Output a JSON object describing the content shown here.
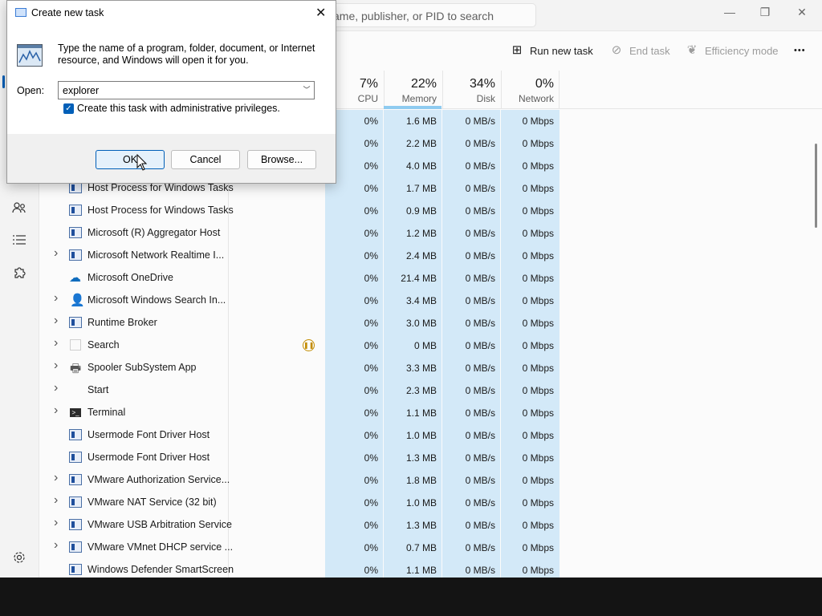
{
  "search": {
    "placeholder": "ame, publisher, or PID to search"
  },
  "window_controls": {
    "minimize": "—",
    "maximize": "❐",
    "close": "✕"
  },
  "toolbar": {
    "run_new_task": "Run new task",
    "end_task": "End task",
    "efficiency_mode": "Efficiency mode",
    "more": "•••"
  },
  "columns": {
    "cpu": {
      "pct": "7%",
      "label": "CPU"
    },
    "memory": {
      "pct": "22%",
      "label": "Memory"
    },
    "disk": {
      "pct": "34%",
      "label": "Disk"
    },
    "network": {
      "pct": "0%",
      "label": "Network"
    }
  },
  "processes": [
    {
      "name": "",
      "expand": false,
      "icon": "none",
      "cpu": "0%",
      "memory": "1.6 MB",
      "disk": "0 MB/s",
      "network": "0 Mbps"
    },
    {
      "name": "",
      "expand": false,
      "icon": "none",
      "cpu": "0%",
      "memory": "2.2 MB",
      "disk": "0 MB/s",
      "network": "0 Mbps"
    },
    {
      "name": "",
      "expand": false,
      "icon": "none",
      "cpu": "0%",
      "memory": "4.0 MB",
      "disk": "0 MB/s",
      "network": "0 Mbps"
    },
    {
      "name": "Host Process for Windows Tasks",
      "expand": false,
      "icon": "app",
      "cpu": "0%",
      "memory": "1.7 MB",
      "disk": "0 MB/s",
      "network": "0 Mbps"
    },
    {
      "name": "Host Process for Windows Tasks",
      "expand": false,
      "icon": "app",
      "cpu": "0%",
      "memory": "0.9 MB",
      "disk": "0 MB/s",
      "network": "0 Mbps"
    },
    {
      "name": "Microsoft (R) Aggregator Host",
      "expand": false,
      "icon": "app",
      "cpu": "0%",
      "memory": "1.2 MB",
      "disk": "0 MB/s",
      "network": "0 Mbps"
    },
    {
      "name": "Microsoft Network Realtime I...",
      "expand": true,
      "icon": "app",
      "cpu": "0%",
      "memory": "2.4 MB",
      "disk": "0 MB/s",
      "network": "0 Mbps"
    },
    {
      "name": "Microsoft OneDrive",
      "expand": false,
      "icon": "cloud",
      "cpu": "0%",
      "memory": "21.4 MB",
      "disk": "0 MB/s",
      "network": "0 Mbps"
    },
    {
      "name": "Microsoft Windows Search In...",
      "expand": true,
      "icon": "search-user",
      "cpu": "0%",
      "memory": "3.4 MB",
      "disk": "0 MB/s",
      "network": "0 Mbps"
    },
    {
      "name": "Runtime Broker",
      "expand": true,
      "icon": "app",
      "cpu": "0%",
      "memory": "3.0 MB",
      "disk": "0 MB/s",
      "network": "0 Mbps"
    },
    {
      "name": "Search",
      "expand": true,
      "icon": "blank",
      "paused": true,
      "cpu": "0%",
      "memory": "0 MB",
      "disk": "0 MB/s",
      "network": "0 Mbps"
    },
    {
      "name": "Spooler SubSystem App",
      "expand": true,
      "icon": "printer",
      "cpu": "0%",
      "memory": "3.3 MB",
      "disk": "0 MB/s",
      "network": "0 Mbps"
    },
    {
      "name": "Start",
      "expand": true,
      "icon": "none",
      "cpu": "0%",
      "memory": "2.3 MB",
      "disk": "0 MB/s",
      "network": "0 Mbps"
    },
    {
      "name": "Terminal",
      "expand": true,
      "icon": "terminal",
      "cpu": "0%",
      "memory": "1.1 MB",
      "disk": "0 MB/s",
      "network": "0 Mbps"
    },
    {
      "name": "Usermode Font Driver Host",
      "expand": false,
      "icon": "app",
      "cpu": "0%",
      "memory": "1.0 MB",
      "disk": "0 MB/s",
      "network": "0 Mbps"
    },
    {
      "name": "Usermode Font Driver Host",
      "expand": false,
      "icon": "app",
      "cpu": "0%",
      "memory": "1.3 MB",
      "disk": "0 MB/s",
      "network": "0 Mbps"
    },
    {
      "name": "VMware Authorization Service...",
      "expand": true,
      "icon": "app",
      "cpu": "0%",
      "memory": "1.8 MB",
      "disk": "0 MB/s",
      "network": "0 Mbps"
    },
    {
      "name": "VMware NAT Service (32 bit)",
      "expand": true,
      "icon": "app",
      "cpu": "0%",
      "memory": "1.0 MB",
      "disk": "0 MB/s",
      "network": "0 Mbps"
    },
    {
      "name": "VMware USB Arbitration Service",
      "expand": true,
      "icon": "app",
      "cpu": "0%",
      "memory": "1.3 MB",
      "disk": "0 MB/s",
      "network": "0 Mbps"
    },
    {
      "name": "VMware VMnet DHCP service ...",
      "expand": true,
      "icon": "app",
      "cpu": "0%",
      "memory": "0.7 MB",
      "disk": "0 MB/s",
      "network": "0 Mbps"
    },
    {
      "name": "Windows Defender SmartScreen",
      "expand": false,
      "icon": "app",
      "cpu": "0%",
      "memory": "1.1 MB",
      "disk": "0 MB/s",
      "network": "0 Mbps"
    }
  ],
  "dialog": {
    "title": "Create new task",
    "close": "✕",
    "description": "Type the name of a program, folder, document, or Internet resource, and Windows will open it for you.",
    "open_label": "Open:",
    "open_value": "explorer",
    "admin_label": "Create this task with administrative privileges.",
    "admin_checked": true,
    "ok": "OK",
    "cancel": "Cancel",
    "browse": "Browse..."
  },
  "colors": {
    "accent": "#005fb8",
    "heat": "#d3e9f8"
  }
}
